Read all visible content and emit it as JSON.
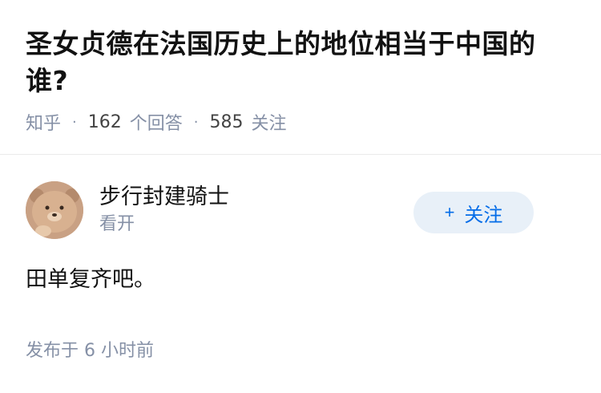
{
  "question": {
    "title": "圣女贞德在法国历史上的地位相当于中国的谁?",
    "source": "知乎",
    "answers_count": "162",
    "answers_label": "个回答",
    "followers_count": "585",
    "followers_label": "关注"
  },
  "answer": {
    "author_name": "步行封建骑士",
    "author_bio": "看开",
    "follow_plus": "+",
    "follow_label": "关注",
    "content": "田单复齐吧。",
    "time_prefix": "发布于",
    "time_value": "6 小时前"
  },
  "colors": {
    "text": "#121212",
    "muted": "#8590a6",
    "accent": "#056de8",
    "follow_bg": "#e8f0f8"
  },
  "icons": {
    "avatar": "bear-avatar"
  }
}
